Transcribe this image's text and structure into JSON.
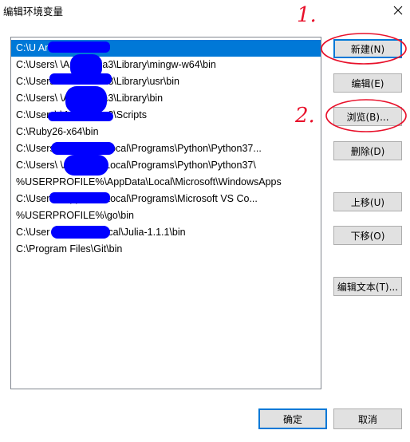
{
  "window": {
    "title": "编辑环境变量"
  },
  "paths": [
    "C:\\U          Anaconda3",
    "C:\\Users\\          \\Anaconda3\\Library\\mingw-w64\\bin",
    "C:\\Users\\          \\Anaconda3\\Library\\usr\\bin",
    "C:\\Users\\          \\Anaconda3\\Library\\bin",
    "C:\\Users\\          \\Anaconda3\\Scripts",
    "C:\\Ruby26-x64\\bin",
    "C:\\Users\\          \\AppData\\Local\\Programs\\Python\\Python37...",
    "C:\\Users\\          \\AppData\\Local\\Programs\\Python\\Python37\\",
    "%USERPROFILE%\\AppData\\Local\\Microsoft\\WindowsApps",
    "C:\\Users\\          \\AppData\\Local\\Programs\\Microsoft VS Co...",
    "%USERPROFILE%\\go\\bin",
    "C:\\User          \\AppData\\Local\\Julia-1.1.1\\bin",
    "C:\\Program Files\\Git\\bin"
  ],
  "buttons": {
    "new": "新建(N)",
    "edit": "编辑(E)",
    "browse": "浏览(B)...",
    "delete": "删除(D)",
    "move_up": "上移(U)",
    "move_down": "下移(O)",
    "edit_text": "编辑文本(T)..."
  },
  "footer": {
    "ok": "确定",
    "cancel": "取消"
  },
  "annotations": {
    "mark1": "1.",
    "mark2": "2."
  },
  "colors": {
    "selection": "#0078d7",
    "annotation": "#e8102a",
    "redaction": "#0000ff"
  }
}
